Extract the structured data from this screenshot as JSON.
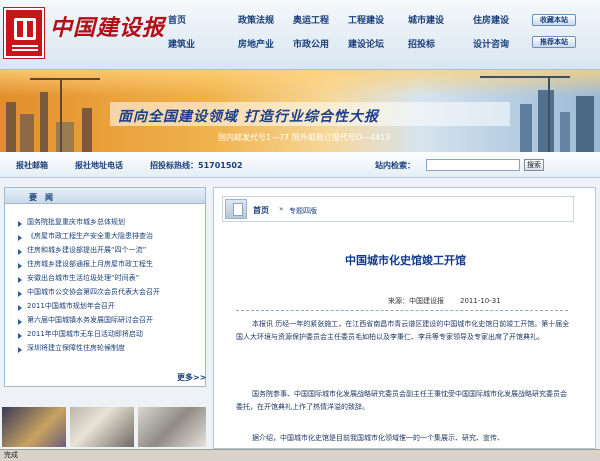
{
  "header": {
    "logo_text": "中国建设报",
    "nav_row1": [
      "首页",
      "政策法规",
      "奥运工程",
      "工程建设",
      "城市建设",
      "住房建设"
    ],
    "nav_row2": [
      "建筑业",
      "房地产业",
      "市政公用",
      "建设论坛",
      "招投标",
      "设计咨询"
    ],
    "favorite_label": "收藏本站",
    "recommend_label": "推荐本站"
  },
  "banner": {
    "slogan": "面向全国建设领域  打造行业综合性大报",
    "sub": "国内邮发代号1—77  国外邮局订报代号D—4413"
  },
  "infobar": {
    "items": [
      "报社邮箱",
      "报社地址电话",
      "招投标热线：51701502"
    ],
    "search_label": "站内检索：",
    "search_value": "",
    "search_button": "搜索"
  },
  "news": {
    "title": "要闻",
    "items": [
      "国务院批复重庆市城乡总体规划",
      "《房屋市政工程生产安全重大隐患排查治",
      "住房和城乡建设部提出开展“四个一流”",
      "住房城乡建设部通报上月房屋市政工程生",
      "安徽出台城市生活垃圾处理“时间表”",
      "中国城市公交协会第四次会员代表大会召开",
      "2011中国城市规划年会召开",
      "第六届中国城镇水务发展国际研讨会召开",
      "2011年中国城市无车日活动即将启动",
      "深圳将建立保障性住房轮候制度"
    ],
    "more": "更多>>"
  },
  "article": {
    "breadcrumb_home": "首页",
    "breadcrumb_sep": "»",
    "breadcrumb_cat": "专题四版",
    "title": "中国城市化史馆竣工开馆",
    "source": "来源：中国建设报",
    "date": "2011-10-31",
    "paragraphs": [
      "本报讯 历经一年的紧张施工，在江西省南昌市青云谱区建设的中国城市化史馆日前竣工开馆。第十届全国人大环境与资源保护委员会主任委员毛如柏以及李秉仁、李兵等专家领导及专家出席了开馆典礼。",
      "国务院参事、中国国际城市化发展战略研究委员会副主任王秉忱受中国国际城市化发展战略研究委员会委托，在开馆典礼上作了热情洋溢的致辞。",
      "据介绍，中国城市化史馆是目前我国城市化领域惟一的一个集展示、研究、宣传、"
    ]
  },
  "status": "完成"
}
